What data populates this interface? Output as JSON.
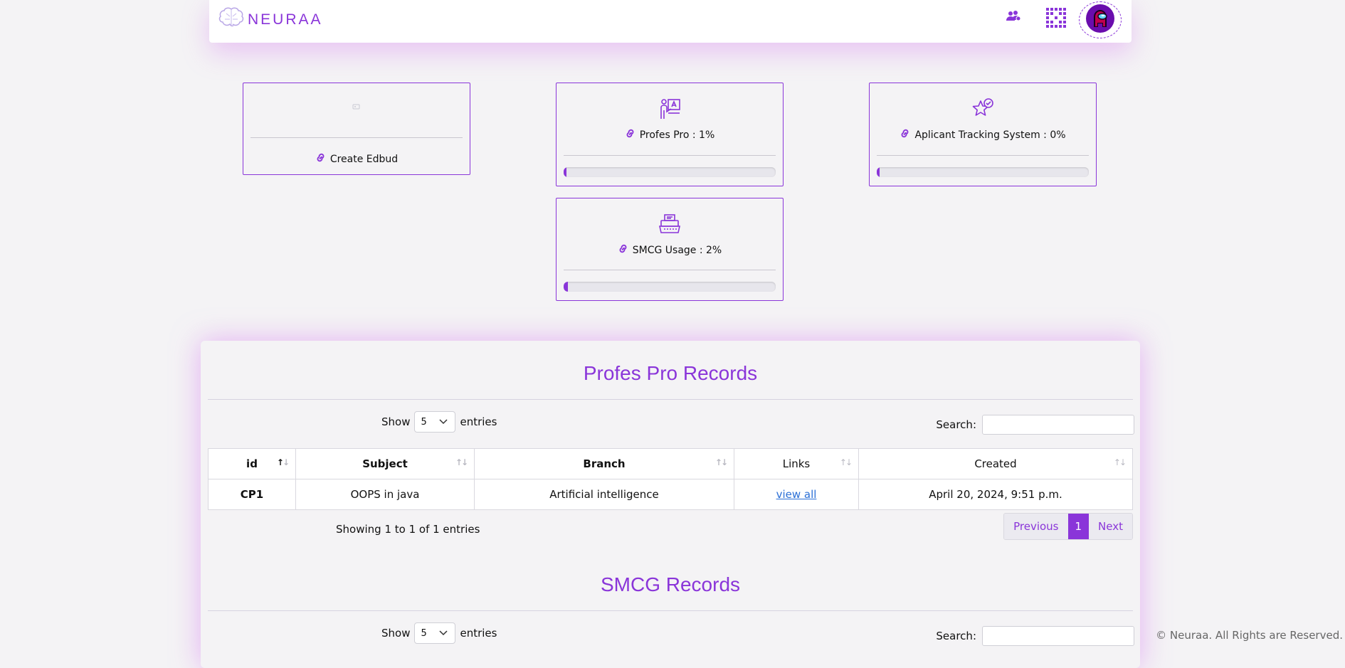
{
  "brand": {
    "name": "NEURAA",
    "logo_icon": "brain-icon"
  },
  "header": {
    "icons": [
      "users-icon",
      "apps-grid-icon"
    ],
    "avatar_icon": "crewmate-avatar-icon"
  },
  "cards": [
    {
      "title": "Create Edbud",
      "icon": "placeholder-icon",
      "link_icon": "link-icon"
    },
    {
      "title": "Profes Pro : 1%",
      "progress_percent": 1,
      "icon": "teacher-board-icon",
      "link_icon": "link-icon"
    },
    {
      "title": "Aplicant Tracking System : 0%",
      "progress_percent": 0,
      "icon": "star-check-icon",
      "link_icon": "link-icon"
    },
    {
      "title": "SMCG Usage : 2%",
      "progress_percent": 2,
      "icon": "typewriter-icon",
      "link_icon": "link-icon"
    }
  ],
  "profes_records": {
    "title": "Profes Pro Records",
    "show_label": "Show",
    "entries_label": "entries",
    "page_size": "5",
    "search_label": "Search:",
    "columns": [
      "id",
      "Subject",
      "Branch",
      "Links",
      "Created"
    ],
    "rows": [
      {
        "id": "CP1",
        "subject": "OOPS in java",
        "branch": "Artificial intelligence",
        "link": "view all",
        "created": "April 20, 2024, 9:51 p.m."
      }
    ],
    "info": "Showing 1 to 1 of 1 entries",
    "pagination": {
      "previous": "Previous",
      "current": "1",
      "next": "Next"
    }
  },
  "smcg_records": {
    "title": "SMCG Records",
    "show_label": "Show",
    "entries_label": "entries",
    "page_size": "5",
    "search_label": "Search:"
  },
  "footer": {
    "text": "© Neuraa. All Rights are Reserved."
  },
  "colors": {
    "accent": "#8a35d9",
    "background": "#f4f3f5",
    "glow": "#e6a9f5",
    "link": "#2a6fd6"
  }
}
